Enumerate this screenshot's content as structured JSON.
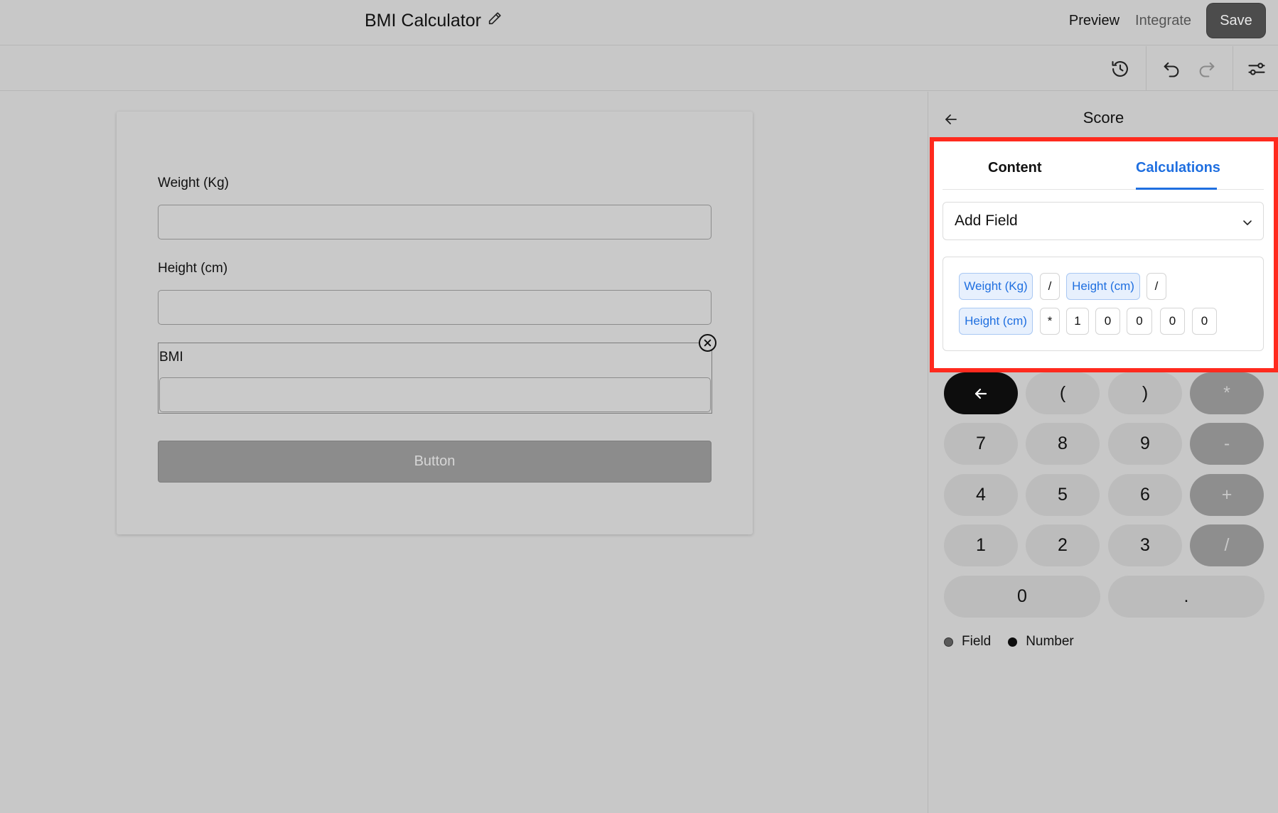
{
  "header": {
    "title": "BMI Calculator",
    "preview_label": "Preview",
    "integrate_label": "Integrate",
    "save_label": "Save"
  },
  "toolbar": {
    "icons": [
      "history-icon",
      "undo-icon",
      "redo-icon",
      "settings-sliders-icon"
    ]
  },
  "form": {
    "fields": [
      {
        "label": "Weight (Kg)",
        "value": ""
      },
      {
        "label": "Height (cm)",
        "value": ""
      },
      {
        "label": "BMI",
        "value": ""
      }
    ],
    "button_label": "Button"
  },
  "panel": {
    "title": "Score",
    "tabs": [
      {
        "label": "Content",
        "active": false
      },
      {
        "label": "Calculations",
        "active": true
      }
    ],
    "add_field_label": "Add Field",
    "formula_tokens": [
      {
        "text": "Weight (Kg)",
        "kind": "field"
      },
      {
        "text": "/",
        "kind": "op"
      },
      {
        "text": "Height (cm)",
        "kind": "field"
      },
      {
        "text": "/",
        "kind": "op"
      },
      {
        "text": "Height (cm)",
        "kind": "field"
      },
      {
        "text": "*",
        "kind": "op"
      },
      {
        "text": "1",
        "kind": "op"
      },
      {
        "text": "0",
        "kind": "op"
      },
      {
        "text": "0",
        "kind": "op"
      },
      {
        "text": "0",
        "kind": "op"
      },
      {
        "text": "0",
        "kind": "op"
      }
    ],
    "keypad": {
      "row1": [
        "(",
        ")",
        "*"
      ],
      "row2": [
        "7",
        "8",
        "9",
        "-"
      ],
      "row3": [
        "4",
        "5",
        "6",
        "+"
      ],
      "row4": [
        "1",
        "2",
        "3",
        "/"
      ],
      "row5": [
        "0",
        "."
      ]
    },
    "legend": {
      "field_label": "Field",
      "number_label": "Number"
    }
  },
  "colors": {
    "accent": "#1f6fe0",
    "highlight": "#ff2a1e",
    "background": "#c8c8c8"
  }
}
